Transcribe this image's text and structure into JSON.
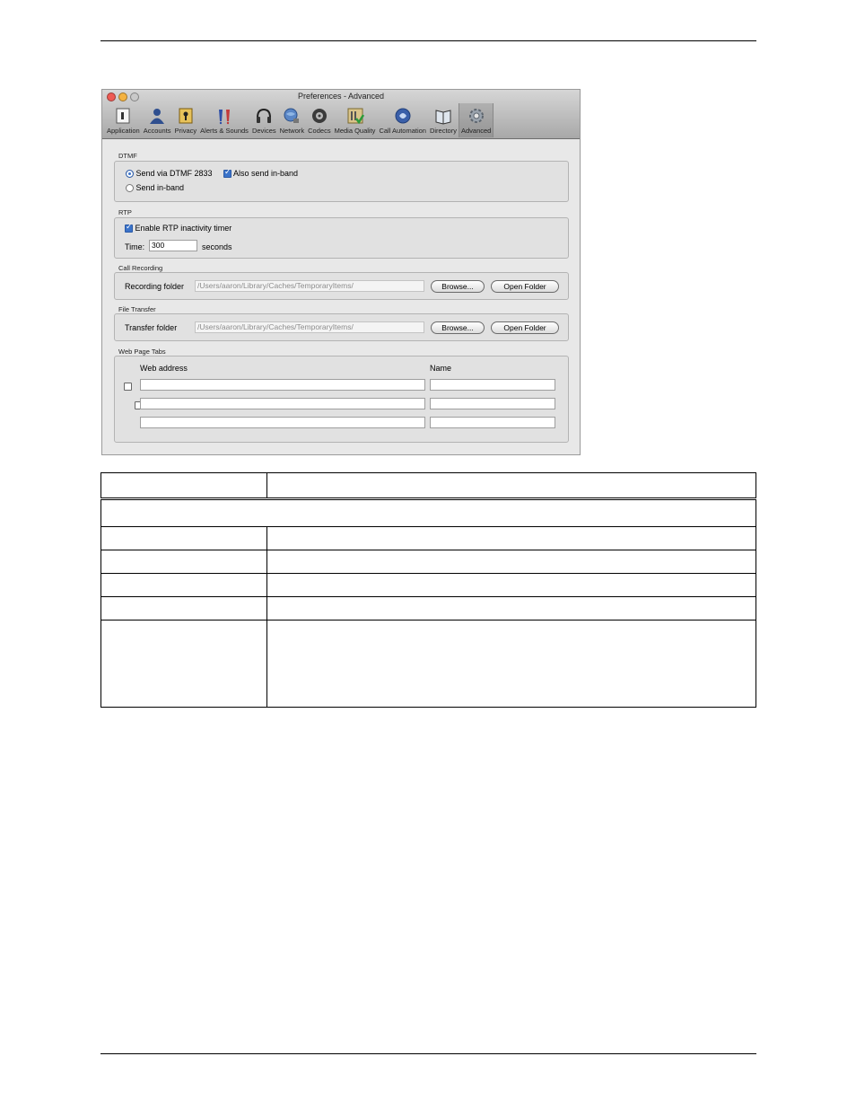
{
  "window": {
    "title": "Preferences - Advanced",
    "traffic_light_colors": [
      "#ee5a53",
      "#f4b23f",
      "#c9c9c9"
    ],
    "toolbar": [
      {
        "label": "Application",
        "icon": "application-icon"
      },
      {
        "label": "Accounts",
        "icon": "accounts-icon"
      },
      {
        "label": "Privacy",
        "icon": "privacy-icon"
      },
      {
        "label": "Alerts & Sounds",
        "icon": "alerts-sounds-icon"
      },
      {
        "label": "Devices",
        "icon": "headset-icon"
      },
      {
        "label": "Network",
        "icon": "network-icon"
      },
      {
        "label": "Codecs",
        "icon": "codecs-icon"
      },
      {
        "label": "Media Quality",
        "icon": "media-quality-icon"
      },
      {
        "label": "Call Automation",
        "icon": "call-automation-icon"
      },
      {
        "label": "Directory",
        "icon": "directory-icon"
      },
      {
        "label": "Advanced",
        "icon": "gear-icon",
        "active": true
      }
    ]
  },
  "dtmf": {
    "label": "DTMF",
    "send_via_2833": "Send via DTMF 2833",
    "also_send_inband": "Also send in-band",
    "send_inband": "Send in-band"
  },
  "rtp": {
    "label": "RTP",
    "enable_timer": "Enable RTP inactivity timer",
    "time_label": "Time:",
    "time_value": "300",
    "seconds": "seconds"
  },
  "call_recording": {
    "label": "Call Recording",
    "folder_label": "Recording folder",
    "folder_path": "/Users/aaron/Library/Caches/TemporaryItems/",
    "browse": "Browse...",
    "open_folder": "Open Folder"
  },
  "file_transfer": {
    "label": "File Transfer",
    "folder_label": "Transfer folder",
    "folder_path": "/Users/aaron/Library/Caches/TemporaryItems/",
    "browse": "Browse...",
    "open_folder": "Open Folder"
  },
  "web_tabs": {
    "label": "Web Page Tabs",
    "col_address": "Web address",
    "col_name": "Name"
  }
}
